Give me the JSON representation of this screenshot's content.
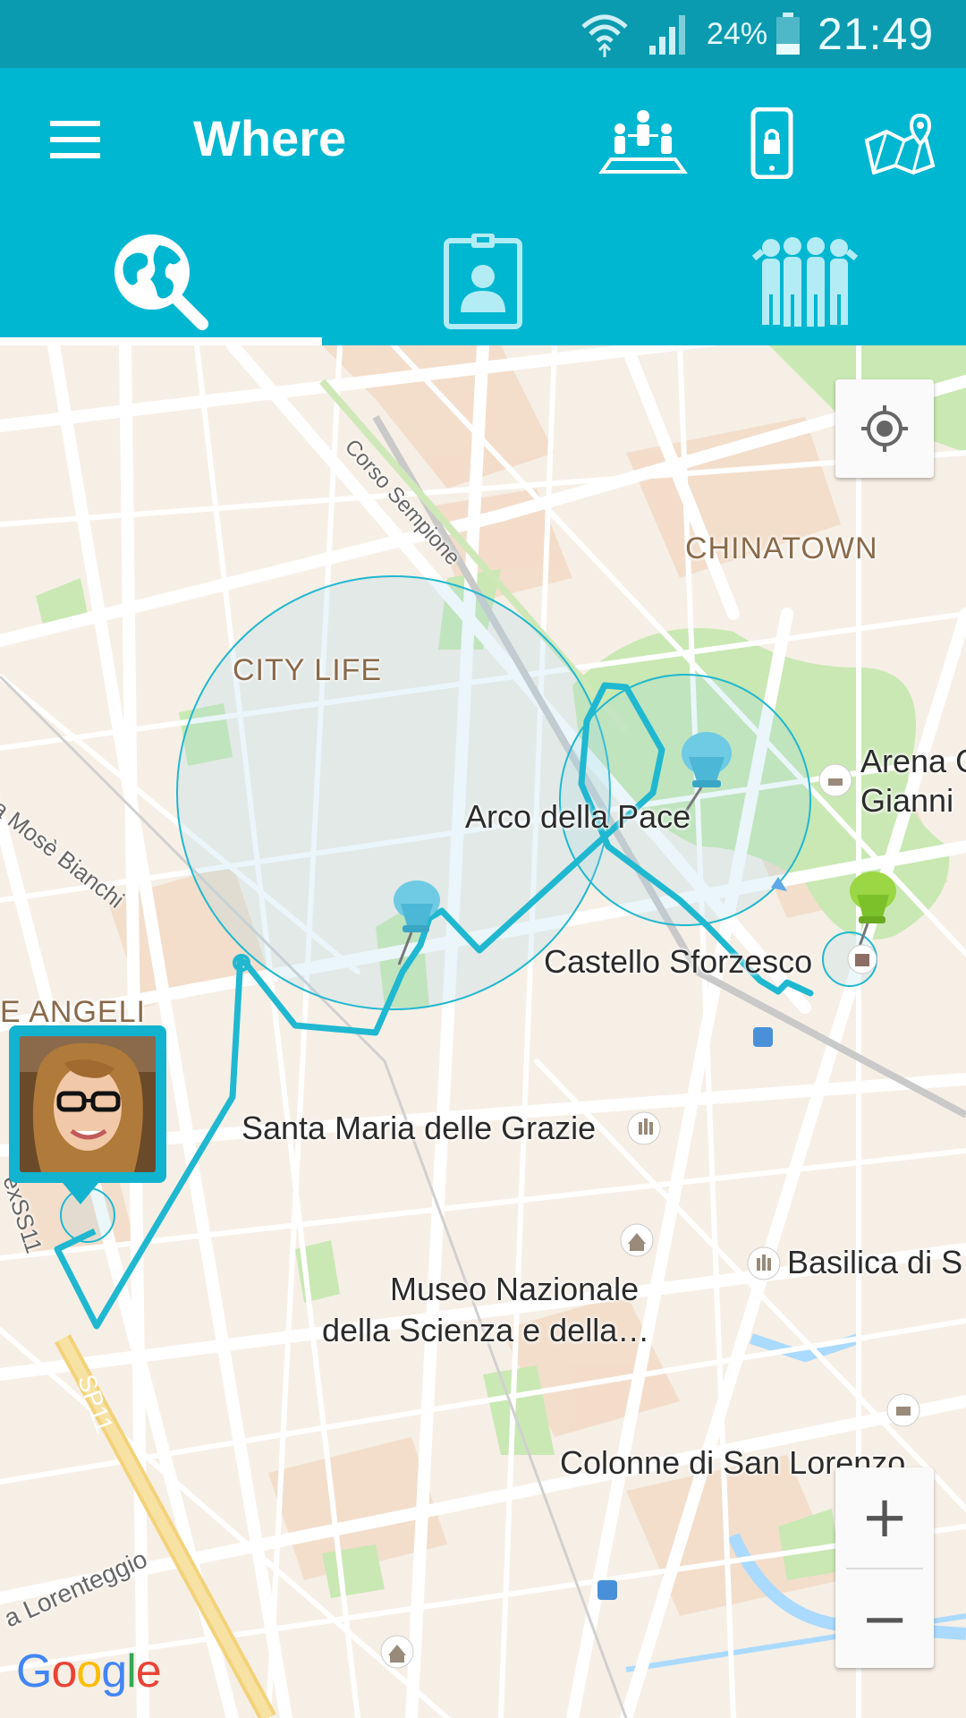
{
  "status_bar": {
    "battery": "24%",
    "time": "21:49"
  },
  "app_bar": {
    "title": "Where",
    "actions": [
      "group-icon",
      "lock-phone-icon",
      "map-pin-icon"
    ]
  },
  "tabs": [
    {
      "icon": "globe-search-icon",
      "selected": true
    },
    {
      "icon": "id-badge-icon",
      "selected": false
    },
    {
      "icon": "people-group-icon",
      "selected": false
    }
  ],
  "map": {
    "districts": {
      "chinatown": "CHINATOWN",
      "city_life": "CITY LIFE",
      "angeli": "E ANGELI"
    },
    "streets": {
      "corso_sempione": "Corso Sempione",
      "mose_bianchi": "ia Mosè Bianchi",
      "sp11": "SP11",
      "ex_ss11": "exSS11",
      "lorenteggio": "a Lorenteggio"
    },
    "pois": {
      "arco": "Arco della Pace",
      "castello": "Castello Sforzesco",
      "arena_line1": "Arena C",
      "arena_line2": "Gianni",
      "santa_maria": "Santa Maria delle Grazie",
      "museo_line1": "Museo Nazionale",
      "museo_line2": "della Scienza e della…",
      "basilica": "Basilica di S",
      "colonne": "Colonne di San Lorenzo"
    },
    "controls": {
      "zoom_in": "+",
      "zoom_out": "−"
    },
    "attribution": "Google",
    "route_color": "#1fb8d0",
    "geofence_color": "#1fb8d0"
  }
}
